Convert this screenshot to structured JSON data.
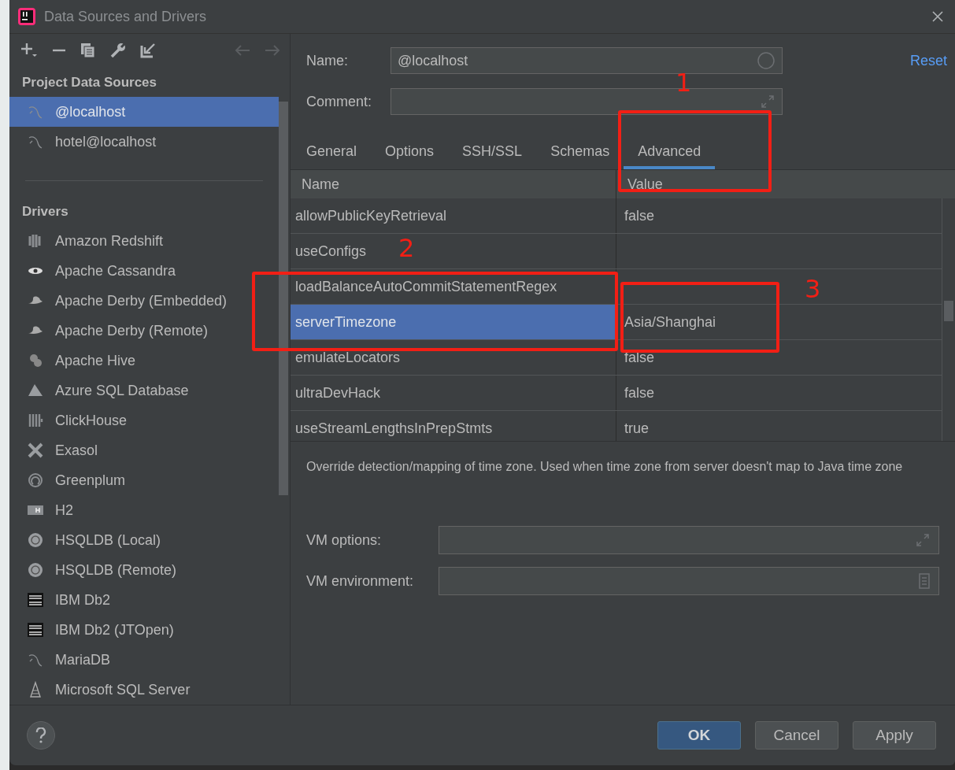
{
  "window": {
    "title": "Data Sources and Drivers"
  },
  "sidebar": {
    "sections": [
      {
        "title": "Project Data Sources",
        "items": [
          {
            "label": "@localhost",
            "selected": true
          },
          {
            "label": "hotel@localhost",
            "selected": false
          }
        ]
      },
      {
        "title": "Drivers",
        "items": [
          {
            "label": "Amazon Redshift",
            "selected": false
          },
          {
            "label": "Apache Cassandra",
            "selected": false
          },
          {
            "label": "Apache Derby (Embedded)",
            "selected": false
          },
          {
            "label": "Apache Derby (Remote)",
            "selected": false
          },
          {
            "label": "Apache Hive",
            "selected": false
          },
          {
            "label": "Azure SQL Database",
            "selected": false
          },
          {
            "label": "ClickHouse",
            "selected": false
          },
          {
            "label": "Exasol",
            "selected": false
          },
          {
            "label": "Greenplum",
            "selected": false
          },
          {
            "label": "H2",
            "selected": false
          },
          {
            "label": "HSQLDB (Local)",
            "selected": false
          },
          {
            "label": "HSQLDB (Remote)",
            "selected": false
          },
          {
            "label": "IBM Db2",
            "selected": false
          },
          {
            "label": "IBM Db2 (JTOpen)",
            "selected": false
          },
          {
            "label": "MariaDB",
            "selected": false
          },
          {
            "label": "Microsoft SQL Server",
            "selected": false
          }
        ]
      }
    ]
  },
  "form": {
    "name_label": "Name:",
    "name_value": "@localhost",
    "comment_label": "Comment:",
    "reset": "Reset"
  },
  "tabs": [
    {
      "label": "General",
      "selected": false
    },
    {
      "label": "Options",
      "selected": false
    },
    {
      "label": "SSH/SSL",
      "selected": false
    },
    {
      "label": "Schemas",
      "selected": false
    },
    {
      "label": "Advanced",
      "selected": true
    }
  ],
  "table": {
    "columns": [
      "Name",
      "Value"
    ],
    "rows": [
      {
        "name": "allowPublicKeyRetrieval",
        "value": "false",
        "selected": false
      },
      {
        "name": "useConfigs",
        "value": "",
        "selected": false
      },
      {
        "name": "loadBalanceAutoCommitStatementRegex",
        "value": "",
        "selected": false
      },
      {
        "name": "serverTimezone",
        "value": "Asia/Shanghai",
        "selected": true
      },
      {
        "name": "emulateLocators",
        "value": "false",
        "selected": false
      },
      {
        "name": "ultraDevHack",
        "value": "false",
        "selected": false
      },
      {
        "name": "useStreamLengthsInPrepStmts",
        "value": "true",
        "selected": false
      }
    ]
  },
  "description": "Override detection/mapping of time zone. Used when time zone from server doesn't map to Java time zone",
  "vm": {
    "options_label": "VM options:",
    "environment_label": "VM environment:"
  },
  "buttons": [
    {
      "label": "OK",
      "kind": "primary"
    },
    {
      "label": "Cancel",
      "kind": "normal"
    },
    {
      "label": "Apply",
      "kind": "normal"
    }
  ],
  "annotations": [
    {
      "label": "1"
    },
    {
      "label": "2"
    },
    {
      "label": "3"
    }
  ]
}
